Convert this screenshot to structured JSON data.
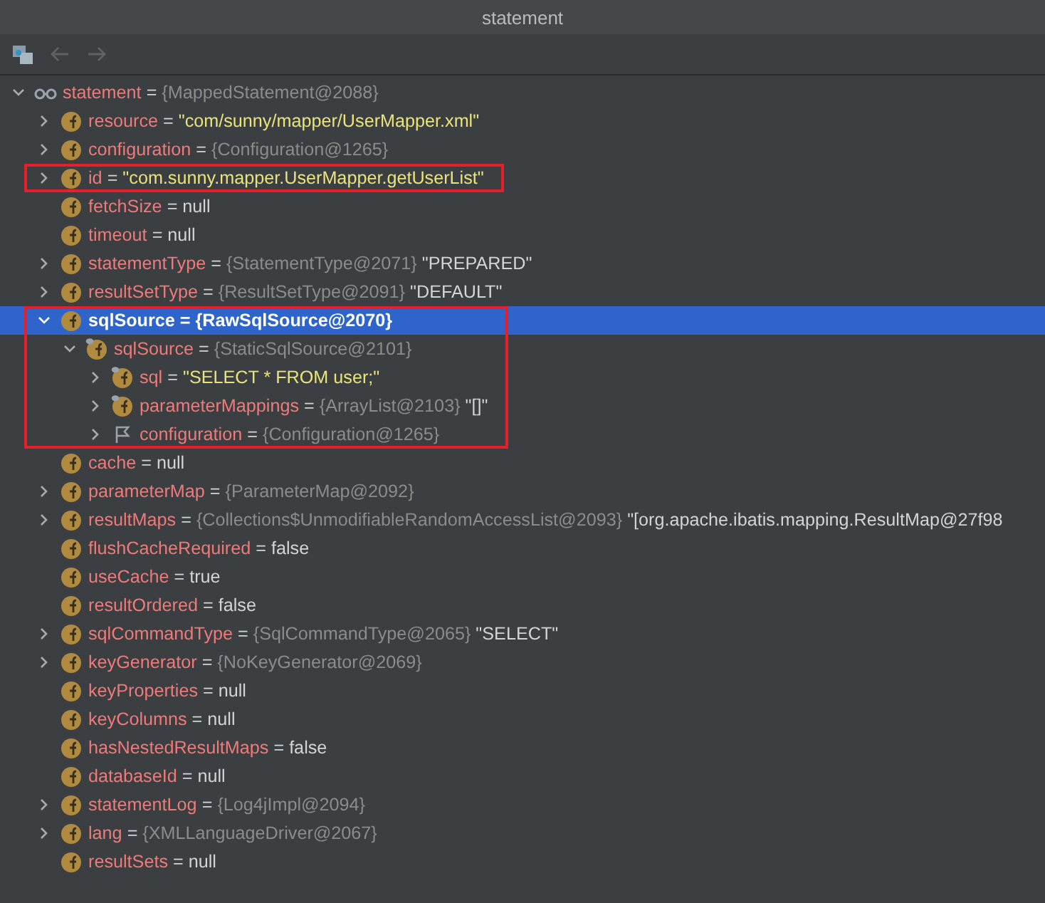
{
  "window": {
    "title": "statement"
  },
  "toolbar": {
    "buttons": [
      {
        "kind": "frames",
        "disabled": false
      },
      {
        "kind": "back",
        "disabled": true
      },
      {
        "kind": "forward",
        "disabled": true
      }
    ]
  },
  "tree": {
    "nodes": [
      {
        "kind": "watch",
        "name": "statement",
        "op": "=",
        "type": "{MappedStatement@2088}",
        "expanded": true,
        "selected": false,
        "boxed": false,
        "children": [
          {
            "kind": "field",
            "name": "resource",
            "op": "=",
            "string": "\"com/sunny/mapper/UserMapper.xml\"",
            "expanded": false,
            "selected": false,
            "boxed": false
          },
          {
            "kind": "field",
            "name": "configuration",
            "op": "=",
            "type": "{Configuration@1265}",
            "expanded": false,
            "selected": false,
            "boxed": false
          },
          {
            "kind": "field",
            "name": "id",
            "op": "=",
            "string": "\"com.sunny.mapper.UserMapper.getUserList\"",
            "expanded": false,
            "selected": false,
            "boxed": true
          },
          {
            "kind": "field",
            "name": "fetchSize",
            "op": "=",
            "value": "null",
            "selected": false,
            "boxed": false
          },
          {
            "kind": "field",
            "name": "timeout",
            "op": "=",
            "value": "null",
            "selected": false,
            "boxed": false
          },
          {
            "kind": "field",
            "name": "statementType",
            "op": "=",
            "type": "{StatementType@2071}",
            "value": "\"PREPARED\"",
            "expanded": false,
            "selected": false,
            "boxed": false
          },
          {
            "kind": "field",
            "name": "resultSetType",
            "op": "=",
            "type": "{ResultSetType@2091}",
            "value": "\"DEFAULT\"",
            "expanded": false,
            "selected": false,
            "boxed": false
          },
          {
            "kind": "field",
            "name": "sqlSource",
            "op": "=",
            "type": "{RawSqlSource@2070}",
            "expanded": true,
            "selected": true,
            "boxed": true,
            "children": [
              {
                "kind": "static-field",
                "name": "sqlSource",
                "op": "=",
                "type": "{StaticSqlSource@2101}",
                "expanded": true,
                "selected": false,
                "children": [
                  {
                    "kind": "static-field",
                    "name": "sql",
                    "op": "=",
                    "string": "\"SELECT * FROM user;\"",
                    "expanded": false,
                    "selected": false
                  },
                  {
                    "kind": "static-field",
                    "name": "parameterMappings",
                    "op": "=",
                    "type": "{ArrayList@2103}",
                    "value": "\"[]\"",
                    "expanded": false,
                    "selected": false
                  },
                  {
                    "kind": "flag",
                    "name": "configuration",
                    "op": "=",
                    "type": "{Configuration@1265}",
                    "expanded": false,
                    "selected": false
                  }
                ]
              }
            ]
          },
          {
            "kind": "field",
            "name": "cache",
            "op": "=",
            "value": "null",
            "selected": false,
            "boxed": false
          },
          {
            "kind": "field",
            "name": "parameterMap",
            "op": "=",
            "type": "{ParameterMap@2092}",
            "expanded": false,
            "selected": false,
            "boxed": false
          },
          {
            "kind": "field",
            "name": "resultMaps",
            "op": "=",
            "type": "{Collections$UnmodifiableRandomAccessList@2093}",
            "value": "\"[org.apache.ibatis.mapping.ResultMap@27f98",
            "expanded": false,
            "selected": false,
            "boxed": false
          },
          {
            "kind": "field",
            "name": "flushCacheRequired",
            "op": "=",
            "value": "false",
            "selected": false,
            "boxed": false
          },
          {
            "kind": "field",
            "name": "useCache",
            "op": "=",
            "value": "true",
            "selected": false,
            "boxed": false
          },
          {
            "kind": "field",
            "name": "resultOrdered",
            "op": "=",
            "value": "false",
            "selected": false,
            "boxed": false
          },
          {
            "kind": "field",
            "name": "sqlCommandType",
            "op": "=",
            "type": "{SqlCommandType@2065}",
            "value": "\"SELECT\"",
            "expanded": false,
            "selected": false,
            "boxed": false
          },
          {
            "kind": "field",
            "name": "keyGenerator",
            "op": "=",
            "type": "{NoKeyGenerator@2069}",
            "expanded": false,
            "selected": false,
            "boxed": false
          },
          {
            "kind": "field",
            "name": "keyProperties",
            "op": "=",
            "value": "null",
            "selected": false,
            "boxed": false
          },
          {
            "kind": "field",
            "name": "keyColumns",
            "op": "=",
            "value": "null",
            "selected": false,
            "boxed": false
          },
          {
            "kind": "field",
            "name": "hasNestedResultMaps",
            "op": "=",
            "value": "false",
            "selected": false,
            "boxed": false
          },
          {
            "kind": "field",
            "name": "databaseId",
            "op": "=",
            "value": "null",
            "selected": false,
            "boxed": false
          },
          {
            "kind": "field",
            "name": "statementLog",
            "op": "=",
            "type": "{Log4jImpl@2094}",
            "expanded": false,
            "selected": false,
            "boxed": false
          },
          {
            "kind": "field",
            "name": "lang",
            "op": "=",
            "type": "{XMLLanguageDriver@2067}",
            "expanded": false,
            "selected": false,
            "boxed": false
          },
          {
            "kind": "field",
            "name": "resultSets",
            "op": "=",
            "value": "null",
            "selected": false,
            "boxed": false
          }
        ]
      }
    ]
  }
}
